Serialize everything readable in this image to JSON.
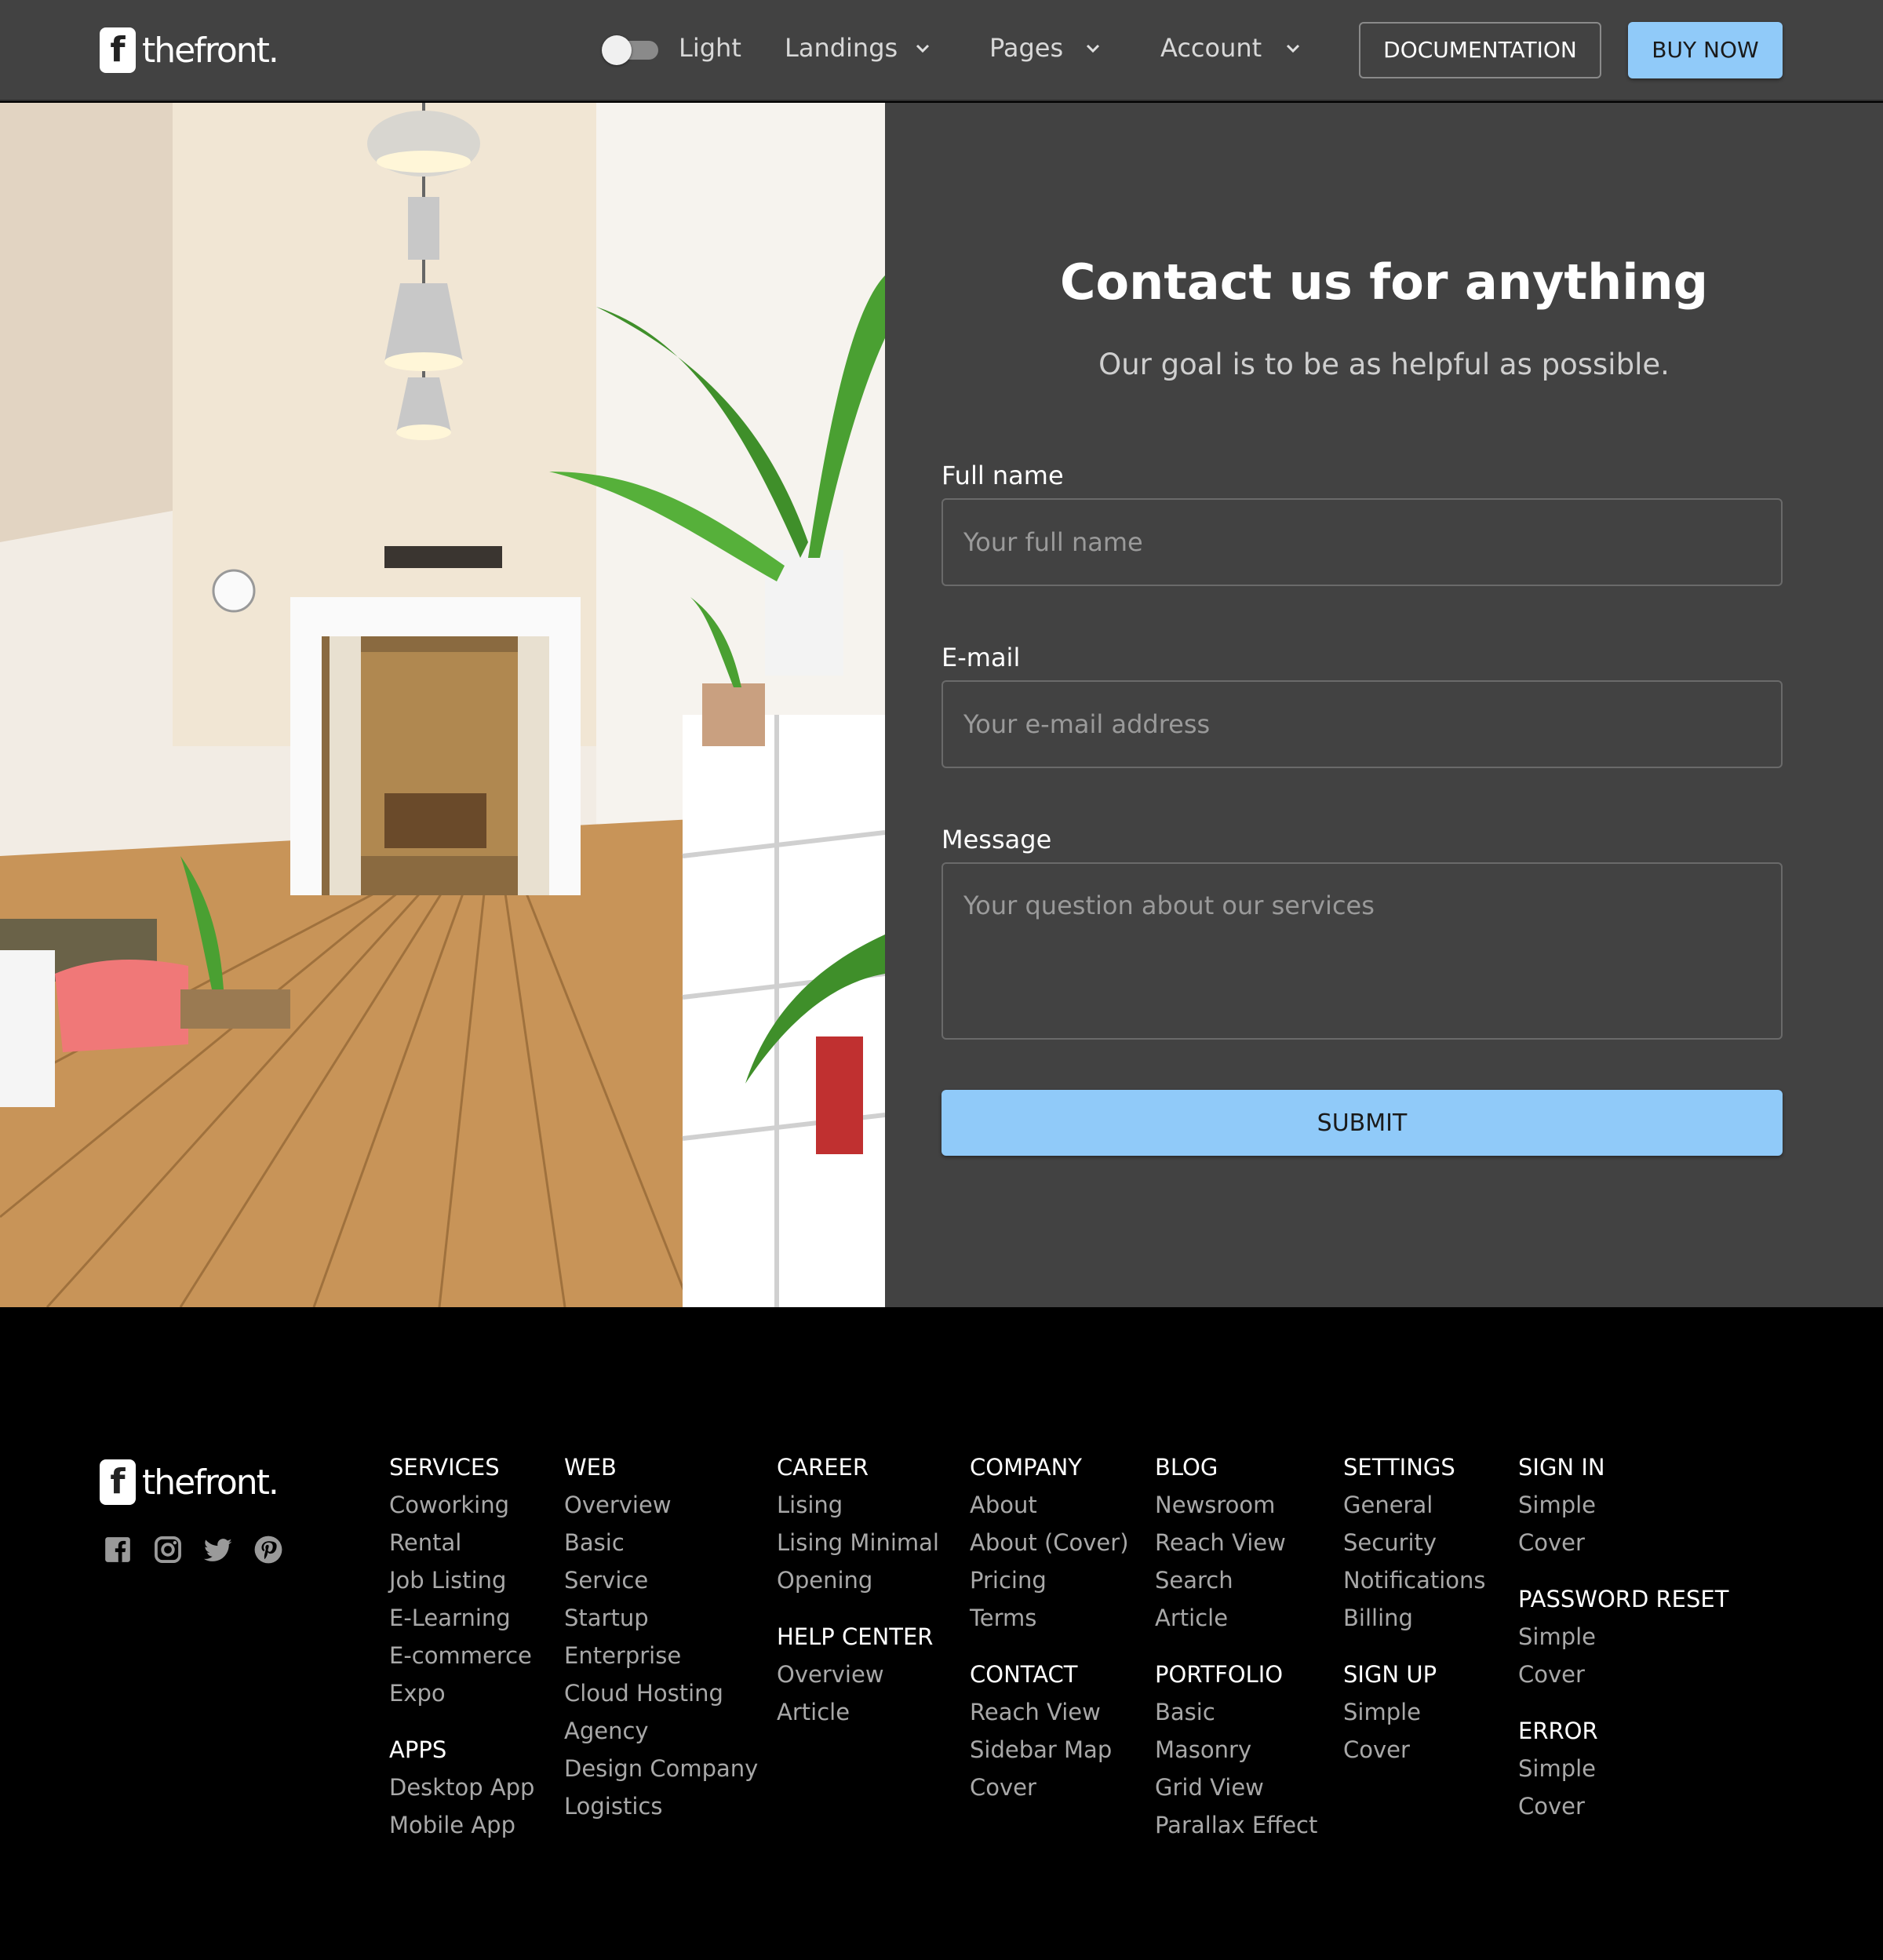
{
  "brand": {
    "mark": "f",
    "name": "thefront."
  },
  "header": {
    "theme_toggle_label": "Light",
    "nav": [
      {
        "label": "Landings"
      },
      {
        "label": "Pages"
      },
      {
        "label": "Account"
      }
    ],
    "documentation_label": "DOCUMENTATION",
    "buy_label": "BUY NOW"
  },
  "contact": {
    "title": "Contact us for anything",
    "subtitle": "Our goal is to be as helpful as possible.",
    "full_name": {
      "label": "Full name",
      "placeholder": "Your full name",
      "value": ""
    },
    "email": {
      "label": "E-mail",
      "placeholder": "Your e-mail address",
      "value": ""
    },
    "message": {
      "label": "Message",
      "placeholder": "Your question about our services",
      "value": ""
    },
    "submit_label": "SUBMIT"
  },
  "footer": {
    "socials": [
      "facebook-icon",
      "instagram-icon",
      "twitter-icon",
      "pinterest-icon"
    ],
    "columns": [
      {
        "groups": [
          {
            "title": "SERVICES",
            "links": [
              "Coworking",
              "Rental",
              "Job Listing",
              "E-Learning",
              "E-commerce",
              "Expo"
            ]
          },
          {
            "title": "APPS",
            "links": [
              "Desktop App",
              "Mobile App"
            ]
          }
        ]
      },
      {
        "groups": [
          {
            "title": "WEB",
            "links": [
              "Overview",
              "Basic",
              "Service",
              "Startup",
              "Enterprise",
              "Cloud Hosting",
              "Agency",
              "Design Company",
              "Logistics"
            ]
          }
        ]
      },
      {
        "groups": [
          {
            "title": "CAREER",
            "links": [
              "Lising",
              "Lising Minimal",
              "Opening"
            ]
          },
          {
            "title": "HELP CENTER",
            "links": [
              "Overview",
              "Article"
            ]
          }
        ]
      },
      {
        "groups": [
          {
            "title": "COMPANY",
            "links": [
              "About",
              "About (Cover)",
              "Pricing",
              "Terms"
            ]
          },
          {
            "title": "CONTACT",
            "links": [
              "Reach View",
              "Sidebar Map",
              "Cover"
            ]
          }
        ]
      },
      {
        "groups": [
          {
            "title": "BLOG",
            "links": [
              "Newsroom",
              "Reach View",
              "Search",
              "Article"
            ]
          },
          {
            "title": "PORTFOLIO",
            "links": [
              "Basic",
              "Masonry",
              "Grid View",
              "Parallax Effect"
            ]
          }
        ]
      },
      {
        "groups": [
          {
            "title": "SETTINGS",
            "links": [
              "General",
              "Security",
              "Notifications",
              "Billing"
            ]
          },
          {
            "title": "SIGN UP",
            "links": [
              "Simple",
              "Cover"
            ]
          }
        ]
      },
      {
        "groups": [
          {
            "title": "SIGN IN",
            "links": [
              "Simple",
              "Cover"
            ]
          },
          {
            "title": "PASSWORD RESET",
            "links": [
              "Simple",
              "Cover"
            ]
          },
          {
            "title": "ERROR",
            "links": [
              "Simple",
              "Cover"
            ]
          }
        ]
      }
    ]
  },
  "colors": {
    "header_bg": "#424242",
    "panel_bg": "#424242",
    "footer_bg": "#000000",
    "accent": "#90caf9"
  }
}
